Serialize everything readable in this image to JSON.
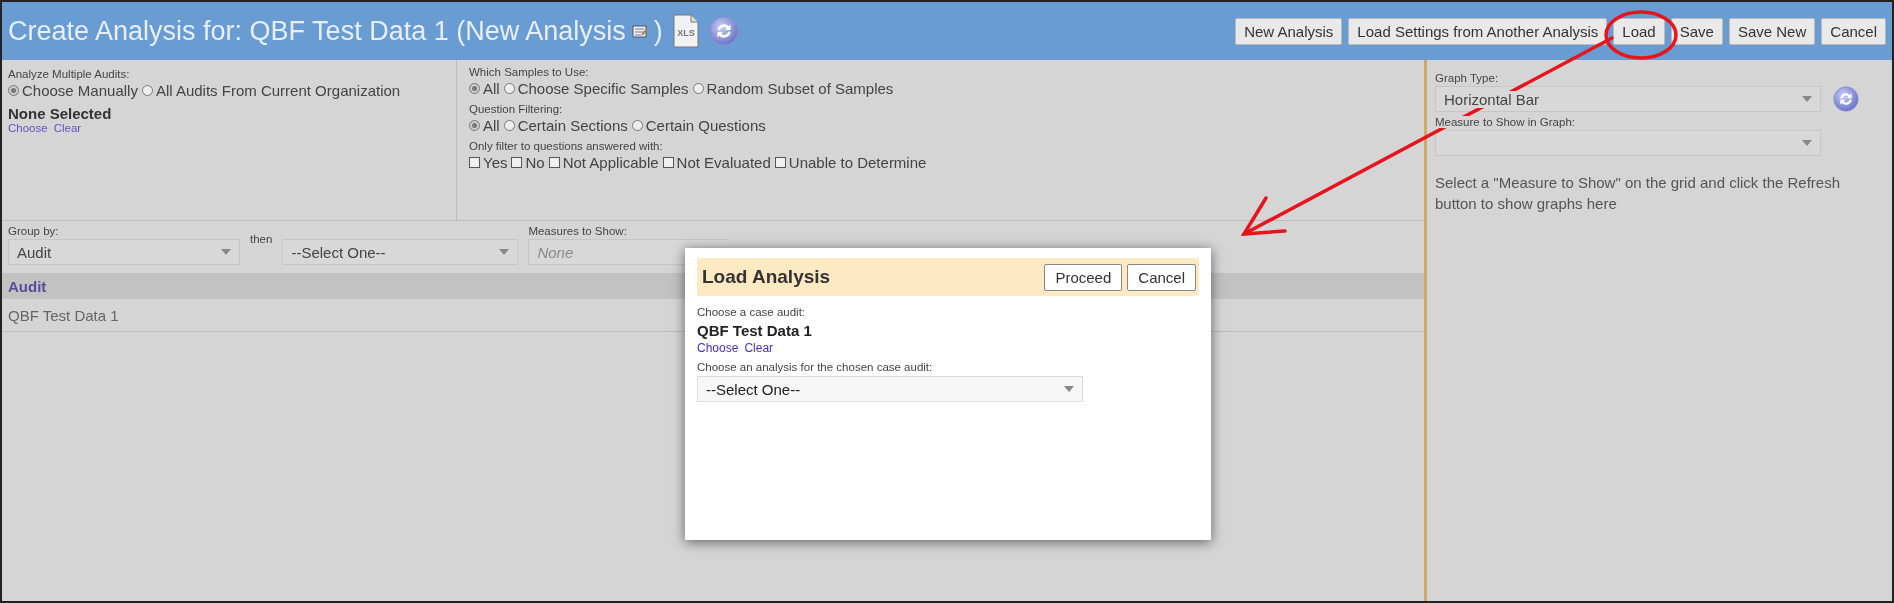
{
  "header": {
    "title": "Create Analysis for: QBF Test Data 1 (New Analysis",
    "title_end": ")",
    "export_label": "XLS",
    "buttons": [
      "New Analysis",
      "Load Settings from Another Analysis",
      "Load",
      "Save",
      "Save New",
      "Cancel"
    ]
  },
  "audits": {
    "label": "Analyze Multiple Audits:",
    "options": [
      {
        "label": "Choose Manually",
        "selected": true
      },
      {
        "label": "All Audits From Current Organization",
        "selected": false
      }
    ],
    "selection": "None Selected",
    "links": [
      "Choose",
      "Clear"
    ]
  },
  "samples": {
    "label": "Which Samples to Use:",
    "options": [
      {
        "label": "All",
        "selected": true
      },
      {
        "label": "Choose Specific Samples",
        "selected": false
      },
      {
        "label": "Random Subset of Samples",
        "selected": false
      }
    ]
  },
  "question_filtering": {
    "label": "Question Filtering:",
    "options": [
      {
        "label": "All",
        "selected": true
      },
      {
        "label": "Certain Sections",
        "selected": false
      },
      {
        "label": "Certain Questions",
        "selected": false
      }
    ]
  },
  "answer_filter": {
    "label": "Only filter to questions answered with:",
    "options": [
      {
        "label": "Yes",
        "checked": false
      },
      {
        "label": "No",
        "checked": false
      },
      {
        "label": "Not Applicable",
        "checked": false
      },
      {
        "label": "Not Evaluated",
        "checked": false
      },
      {
        "label": "Unable to Determine",
        "checked": false
      }
    ]
  },
  "group_by": {
    "label": "Group by:",
    "value": "Audit",
    "then_label": "then",
    "then_value": "--Select One--",
    "measures_label": "Measures to Show:",
    "measures_placeholder": "None"
  },
  "grid": {
    "column": "Audit",
    "rows": [
      "QBF Test Data 1"
    ]
  },
  "graph": {
    "type_label": "Graph Type:",
    "type_value": "Horizontal Bar",
    "measure_label": "Measure to Show in Graph:",
    "hint": "Select a \"Measure to Show\" on the grid and click the Refresh button to show graphs here"
  },
  "modal": {
    "title": "Load Analysis",
    "buttons": [
      "Proceed",
      "Cancel"
    ],
    "case_label": "Choose a case audit:",
    "case_value": "QBF Test Data 1",
    "links": [
      "Choose",
      "Clear"
    ],
    "analysis_label": "Choose an analysis for the chosen case audit:",
    "analysis_value": "--Select One--"
  }
}
